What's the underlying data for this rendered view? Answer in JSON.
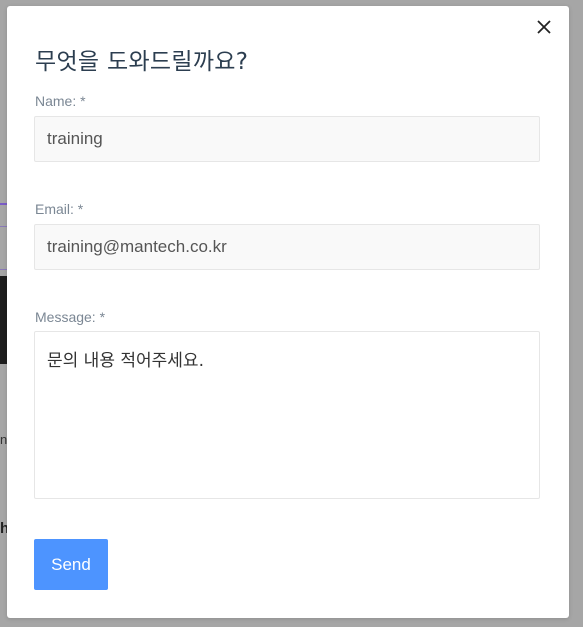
{
  "modal": {
    "title": "무엇을 도와드릴까요?",
    "close_icon": "close-icon"
  },
  "form": {
    "name_label": "Name: *",
    "name_value": "training",
    "email_label": "Email: *",
    "email_value": "training@mantech.co.kr",
    "message_label": "Message: *",
    "message_value": "문의 내용 적어주세요.",
    "send_label": "Send"
  },
  "background": {
    "text1": "na",
    "text2": "h"
  },
  "colors": {
    "accent": "#4d94ff",
    "overlay": "#a6a6a6",
    "title": "#2c3e50",
    "label": "#7b8794"
  }
}
